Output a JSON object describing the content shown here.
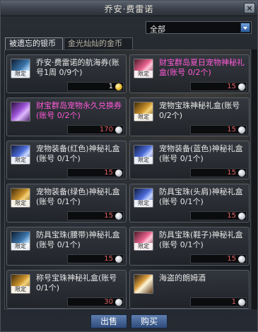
{
  "window": {
    "title": "乔安·费雷诺"
  },
  "filter": {
    "selected": "全部"
  },
  "tabs": [
    {
      "label": "被遗忘的银币"
    },
    {
      "label": "金光灿灿的金币"
    }
  ],
  "items": [
    {
      "name": "乔安·费雷诺的航海券(账号1周 0/9个)",
      "price": "1",
      "badge": "限定",
      "icon": "crystal",
      "pink": false,
      "coin": "gold",
      "price_white": true
    },
    {
      "name": "财宝群岛夏日宠物神秘礼盒(账号 0/2个)",
      "price": "15",
      "badge": "限定",
      "icon": "pinkchest",
      "pink": true,
      "coin": "silver",
      "price_white": false
    },
    {
      "name": "财宝群岛宠物永久兑换券(账号 0/2个)",
      "price": "170",
      "badge": "",
      "icon": "purple",
      "pink": true,
      "coin": "silver",
      "price_white": false
    },
    {
      "name": "宠物宝珠神秘礼盒(账号 0/2个)",
      "price": "15",
      "badge": "限定",
      "icon": "chest",
      "pink": false,
      "coin": "silver",
      "price_white": false
    },
    {
      "name": "宠物装备(红色)神秘礼盒(账号 0/1个)",
      "price": "15",
      "badge": "限定",
      "icon": "bluebox",
      "pink": false,
      "coin": "silver",
      "price_white": false
    },
    {
      "name": "宠物装备(蓝色)神秘礼盒(账号 0/1个)",
      "price": "15",
      "badge": "限定",
      "icon": "bluebox",
      "pink": false,
      "coin": "silver",
      "price_white": false
    },
    {
      "name": "宠物装备(绿色)神秘礼盒(账号 0/1个)",
      "price": "15",
      "badge": "限定",
      "icon": "chest",
      "pink": false,
      "coin": "silver",
      "price_white": false
    },
    {
      "name": "防具宝珠(头肩)神秘礼盒(账号 0/1个)",
      "price": "15",
      "badge": "限定",
      "icon": "bluebox",
      "pink": false,
      "coin": "silver",
      "price_white": false
    },
    {
      "name": "防具宝珠(腰带)神秘礼盒(账号 0/1个)",
      "price": "15",
      "badge": "限定",
      "icon": "crystal",
      "pink": false,
      "coin": "silver",
      "price_white": false
    },
    {
      "name": "防具宝珠(鞋子)神秘礼盒(账号 0/1个)",
      "price": "15",
      "badge": "限定",
      "icon": "pinkchest",
      "pink": false,
      "coin": "silver",
      "price_white": false
    },
    {
      "name": "称号宝珠神秘礼盒(账号 0/1个)",
      "price": "30",
      "badge": "限定",
      "icon": "chest",
      "pink": false,
      "coin": "silver",
      "price_white": false
    },
    {
      "name": "海盗的朗姆酒",
      "price": "1",
      "badge": "",
      "icon": "beer",
      "pink": false,
      "coin": "silver",
      "price_white": false
    }
  ],
  "buttons": {
    "sell": "出售",
    "buy": "购买"
  }
}
